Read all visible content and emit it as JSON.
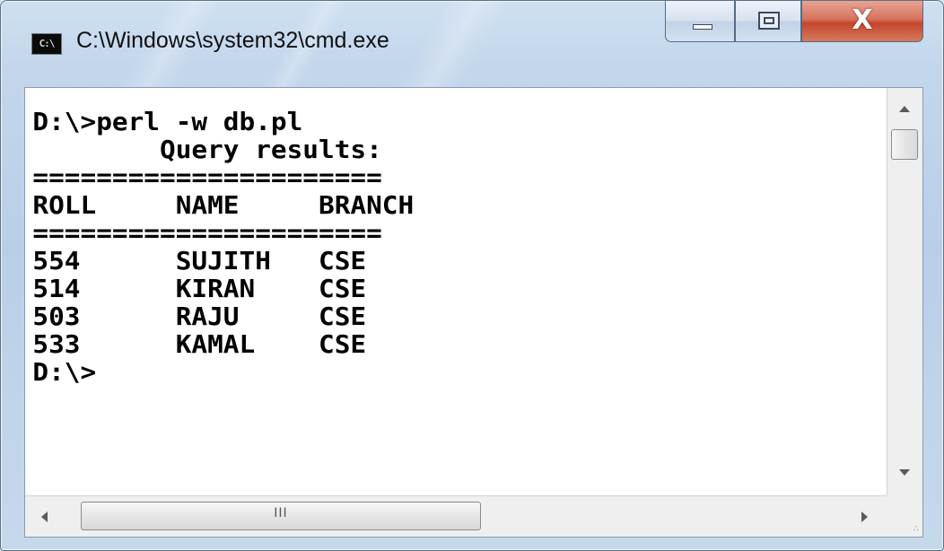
{
  "window": {
    "title": "C:\\Windows\\system32\\cmd.exe",
    "icon_label": "C:\\",
    "icon": "cmd-icon",
    "buttons": {
      "minimize_icon": "minimize-icon",
      "maximize_icon": "maximize-icon",
      "close_icon": "close-icon",
      "close_glyph": "X"
    }
  },
  "console": {
    "lines": [
      "D:\\>perl -w db.pl",
      "        Query results:",
      "======================",
      "ROLL     NAME     BRANCH",
      "======================",
      "554      SUJITH   CSE",
      "514      KIRAN    CSE",
      "503      RAJU     CSE",
      "533      KAMAL    CSE",
      "D:\\>"
    ]
  },
  "scrollbars": {
    "horizontal_grip": "III",
    "resize_grip": "∴"
  },
  "colors": {
    "title_bar": "#c3d6ec",
    "close_button": "#c4452b",
    "console_background": "#ffffff",
    "console_text": "#000000"
  }
}
